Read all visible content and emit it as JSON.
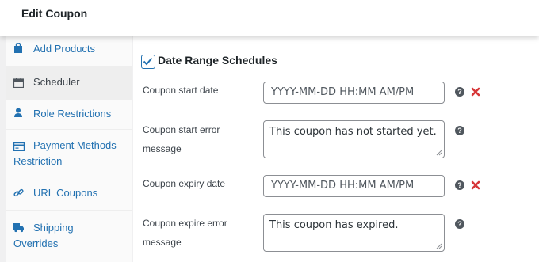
{
  "header": {
    "title": "Edit Coupon"
  },
  "sidebar": {
    "items": [
      {
        "label": "Add Products",
        "icon": "bag-icon",
        "active": false
      },
      {
        "label": "Scheduler",
        "icon": "calendar-icon",
        "active": true
      },
      {
        "label": "Role Restrictions",
        "icon": "user-icon",
        "active": false
      },
      {
        "label": "Payment Methods Restriction",
        "line1": "Payment Methods",
        "line2": "Restriction",
        "icon": "credit-card-icon",
        "active": false
      },
      {
        "label": "URL Coupons",
        "icon": "link-icon",
        "active": false
      },
      {
        "label": "Shipping Overrides",
        "line1": "Shipping",
        "line2": "Overrides",
        "icon": "truck-icon",
        "active": false
      }
    ]
  },
  "scheduler": {
    "section_title": "Date Range Schedules",
    "enabled": true,
    "fields": {
      "start_date": {
        "label": "Coupon start date",
        "placeholder": "YYYY-MM-DD HH:MM AM/PM",
        "value": ""
      },
      "start_error": {
        "label_line1": "Coupon start error",
        "label_line2": "message",
        "value": "This coupon has not started yet."
      },
      "expiry_date": {
        "label": "Coupon expiry date",
        "placeholder": "YYYY-MM-DD HH:MM AM/PM",
        "value": ""
      },
      "expire_error": {
        "label_line1": "Coupon expire error",
        "label_line2": "message",
        "value": "This coupon has expired."
      }
    },
    "help_glyph": "?"
  },
  "colors": {
    "accent": "#2271b1",
    "clear": "#d63638",
    "text": "#3c434a"
  }
}
